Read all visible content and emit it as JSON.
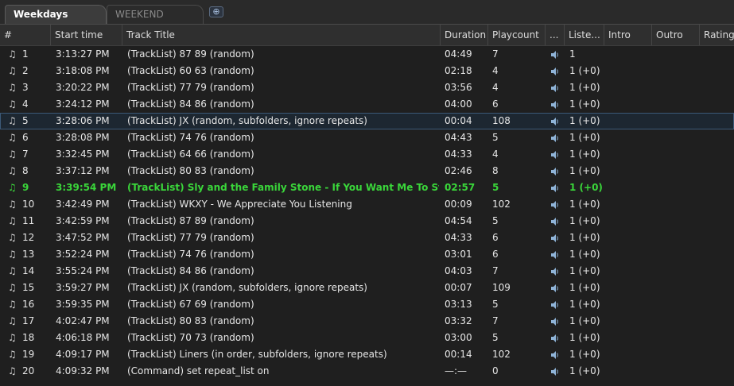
{
  "tabs": {
    "active_label": "Weekdays",
    "inactive_label": "WEEKEND",
    "add_icon": "add-tab-icon"
  },
  "columns": [
    "#",
    "Start time",
    "Track Title",
    "Duration",
    "Playcount",
    "...",
    "Liste...",
    "Intro",
    "Outro",
    "Rating"
  ],
  "colors": {
    "playing": "#3ad63a",
    "selected_border": "#3c5978",
    "speaker": "#8fb4d8"
  },
  "rows": [
    {
      "num": "1",
      "time": "3:13:27 PM",
      "title": "(TrackList) 87 89 (random)",
      "duration": "04:49",
      "playcount": "7",
      "listeners": "1"
    },
    {
      "num": "2",
      "time": "3:18:08 PM",
      "title": "(TrackList) 60 63 (random)",
      "duration": "02:18",
      "playcount": "4",
      "listeners": "1 (+0)"
    },
    {
      "num": "3",
      "time": "3:20:22 PM",
      "title": "(TrackList) 77 79 (random)",
      "duration": "03:56",
      "playcount": "4",
      "listeners": "1 (+0)"
    },
    {
      "num": "4",
      "time": "3:24:12 PM",
      "title": "(TrackList) 84 86 (random)",
      "duration": "04:00",
      "playcount": "6",
      "listeners": "1 (+0)"
    },
    {
      "num": "5",
      "time": "3:28:06 PM",
      "title": "(TrackList) JX (random, subfolders, ignore repeats)",
      "duration": "00:04",
      "playcount": "108",
      "listeners": "1 (+0)",
      "selected": true
    },
    {
      "num": "6",
      "time": "3:28:08 PM",
      "title": "(TrackList) 74 76 (random)",
      "duration": "04:43",
      "playcount": "5",
      "listeners": "1 (+0)"
    },
    {
      "num": "7",
      "time": "3:32:45 PM",
      "title": "(TrackList) 64 66 (random)",
      "duration": "04:33",
      "playcount": "4",
      "listeners": "1 (+0)"
    },
    {
      "num": "8",
      "time": "3:37:12 PM",
      "title": "(TrackList) 80 83 (random)",
      "duration": "02:46",
      "playcount": "8",
      "listeners": "1 (+0)"
    },
    {
      "num": "9",
      "time": "3:39:54 PM",
      "title": "(TrackList) Sly and the Family Stone - If You Want Me To Stay",
      "duration": "02:57",
      "playcount": "5",
      "listeners": "1 (+0)",
      "playing": true
    },
    {
      "num": "10",
      "time": "3:42:49 PM",
      "title": "(TrackList) WKXY - We Appreciate You Listening",
      "duration": "00:09",
      "playcount": "102",
      "listeners": "1 (+0)"
    },
    {
      "num": "11",
      "time": "3:42:59 PM",
      "title": "(TrackList) 87 89 (random)",
      "duration": "04:54",
      "playcount": "5",
      "listeners": "1 (+0)"
    },
    {
      "num": "12",
      "time": "3:47:52 PM",
      "title": "(TrackList) 77 79 (random)",
      "duration": "04:33",
      "playcount": "6",
      "listeners": "1 (+0)"
    },
    {
      "num": "13",
      "time": "3:52:24 PM",
      "title": "(TrackList) 74 76 (random)",
      "duration": "03:01",
      "playcount": "6",
      "listeners": "1 (+0)"
    },
    {
      "num": "14",
      "time": "3:55:24 PM",
      "title": "(TrackList) 84 86 (random)",
      "duration": "04:03",
      "playcount": "7",
      "listeners": "1 (+0)"
    },
    {
      "num": "15",
      "time": "3:59:27 PM",
      "title": "(TrackList) JX (random, subfolders, ignore repeats)",
      "duration": "00:07",
      "playcount": "109",
      "listeners": "1 (+0)"
    },
    {
      "num": "16",
      "time": "3:59:35 PM",
      "title": "(TrackList) 67 69 (random)",
      "duration": "03:13",
      "playcount": "5",
      "listeners": "1 (+0)"
    },
    {
      "num": "17",
      "time": "4:02:47 PM",
      "title": "(TrackList) 80 83 (random)",
      "duration": "03:32",
      "playcount": "7",
      "listeners": "1 (+0)"
    },
    {
      "num": "18",
      "time": "4:06:18 PM",
      "title": "(TrackList) 70 73 (random)",
      "duration": "03:00",
      "playcount": "5",
      "listeners": "1 (+0)"
    },
    {
      "num": "19",
      "time": "4:09:17 PM",
      "title": "(TrackList) Liners (in order, subfolders, ignore repeats)",
      "duration": "00:14",
      "playcount": "102",
      "listeners": "1 (+0)"
    },
    {
      "num": "20",
      "time": "4:09:32 PM",
      "title": "(Command) set repeat_list on",
      "duration": "—:—",
      "playcount": "0",
      "listeners": "1 (+0)"
    }
  ]
}
